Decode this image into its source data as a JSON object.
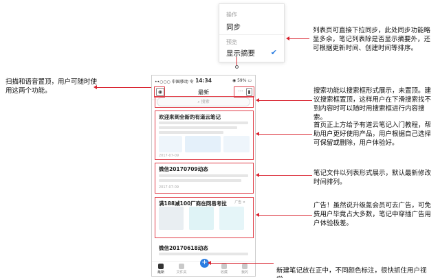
{
  "dropdown": {
    "section_action": "操作",
    "item_sync": "同步",
    "section_preview": "预览",
    "item_show_summary": "显示摘要",
    "check_icon": "check-icon"
  },
  "phone": {
    "status": {
      "carrier": "••○○○ 中国移动 令",
      "time": "14:34",
      "battery": "◉ 59% ▭"
    },
    "nav": {
      "title": "最新",
      "scan_icon": "camera-icon",
      "more_icon": "more-icon",
      "voice_icon": "microphone-icon"
    },
    "search": {
      "placeholder": "搜索"
    },
    "cards": [
      {
        "title": "欢迎来到全新的有道云笔记",
        "date": "2017-07-09"
      },
      {
        "title": "微信20170709动态",
        "date": "2017-07-09"
      },
      {
        "title": "满188减100厂商在网易考拉",
        "tag": "广告 ×"
      },
      {
        "title": "微信20170618动态"
      }
    ],
    "tabs": [
      "最新",
      "文件夹",
      "",
      "收藏",
      "我的"
    ],
    "fab_icon": "plus-icon"
  },
  "annotations": {
    "top_right": "列表页可直接下拉同步，此处同步功能略显多余，笔记列表除是否显示摘要外，还可根据更新时间、创建时间等排序。",
    "left": "扫描和语音置顶，用户可随时使用这两个功能。",
    "search": "搜索功能以搜索框形式展示，未置顶。建议搜索框置顶，这样用户在下滑搜索找不到内容时可以随时用搜索框进行内容搜索。",
    "tutorial": "首页正上方给予有道云笔记入门教程，帮助用户更好使用产品，用户根据自己选择可保留或删除，用户体验好。",
    "notes_list": "笔记文件以列表形式展示，默认最新修改时间排列。",
    "ads": "广告！虽然说升级氪会员可去广告，可免费用户毕竟占大多数，笔记中穿插广告用户体验极差。",
    "new_note": "新建笔记放在正中，不同颜色标注，很快抓住用户视觉。"
  },
  "colors": {
    "accent": "#2b7de1",
    "annotation_red": "#d9232f"
  }
}
